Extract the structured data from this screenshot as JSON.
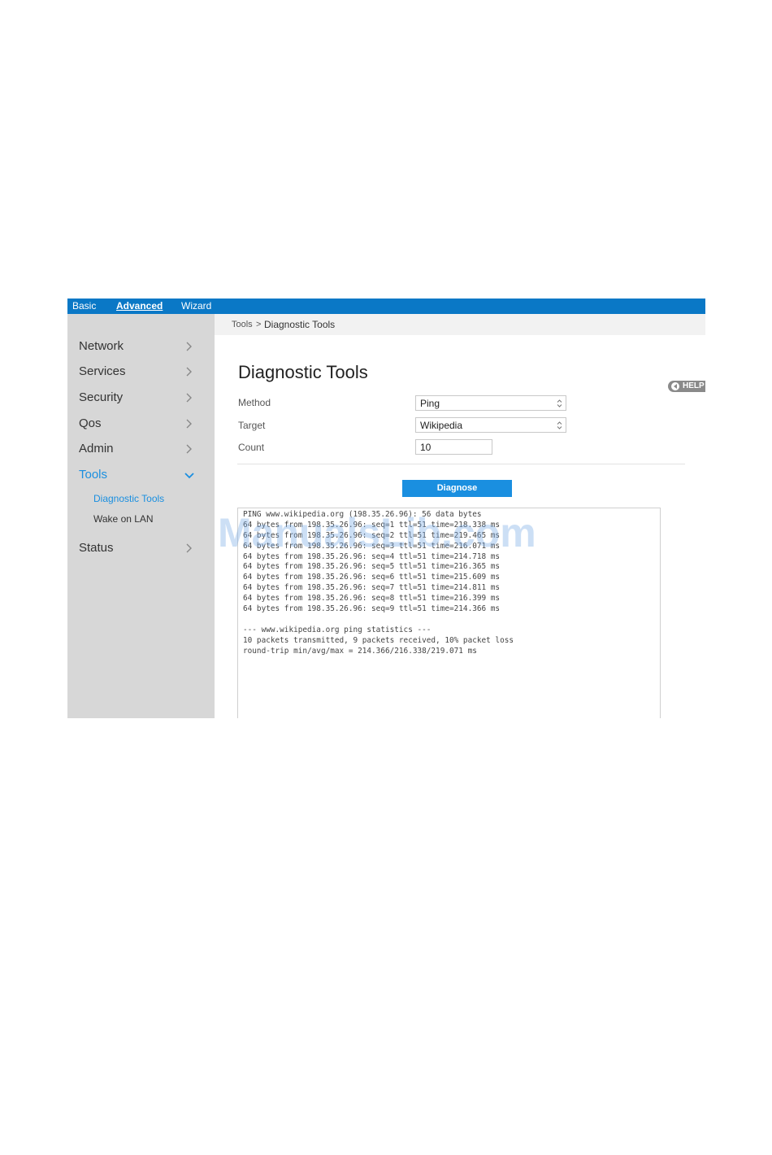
{
  "topnav": {
    "tabs": [
      {
        "label": "Basic"
      },
      {
        "label": "Advanced",
        "active": true
      },
      {
        "label": "Wizard"
      }
    ]
  },
  "sidebar": {
    "items": [
      {
        "label": "Network"
      },
      {
        "label": "Services"
      },
      {
        "label": "Security"
      },
      {
        "label": "Qos"
      },
      {
        "label": "Admin"
      },
      {
        "label": "Tools",
        "expanded": true
      },
      {
        "label": "Status"
      }
    ],
    "subitems": [
      {
        "label": "Diagnostic Tools",
        "active": true
      },
      {
        "label": "Wake on LAN"
      }
    ]
  },
  "breadcrumb": {
    "parent": "Tools",
    "separator": ">",
    "current": "Diagnostic Tools"
  },
  "page": {
    "title": "Diagnostic Tools",
    "help_label": "HELP"
  },
  "form": {
    "method_label": "Method",
    "method_value": "Ping",
    "target_label": "Target",
    "target_value": "Wikipedia",
    "count_label": "Count",
    "count_value": "10",
    "diagnose_label": "Diagnose"
  },
  "output": {
    "lines": [
      "PING www.wikipedia.org (198.35.26.96): 56 data bytes",
      "64 bytes from 198.35.26.96: seq=1 ttl=51 time=218.338 ms",
      "64 bytes from 198.35.26.96: seq=2 ttl=51 time=219.465 ms",
      "64 bytes from 198.35.26.96: seq=3 ttl=51 time=216.071 ms",
      "64 bytes from 198.35.26.96: seq=4 ttl=51 time=214.718 ms",
      "64 bytes from 198.35.26.96: seq=5 ttl=51 time=216.365 ms",
      "64 bytes from 198.35.26.96: seq=6 ttl=51 time=215.609 ms",
      "64 bytes from 198.35.26.96: seq=7 ttl=51 time=214.811 ms",
      "64 bytes from 198.35.26.96: seq=8 ttl=51 time=216.399 ms",
      "64 bytes from 198.35.26.96: seq=9 ttl=51 time=214.366 ms",
      "",
      "--- www.wikipedia.org ping statistics ---",
      "10 packets transmitted, 9 packets received, 10% packet loss",
      "round-trip min/avg/max = 214.366/216.338/219.071 ms"
    ]
  },
  "watermark": "ManualsLib.com",
  "colors": {
    "topbar": "#0a78c6",
    "accent": "#1a8fe0",
    "sidebar": "#d7d7d7"
  }
}
